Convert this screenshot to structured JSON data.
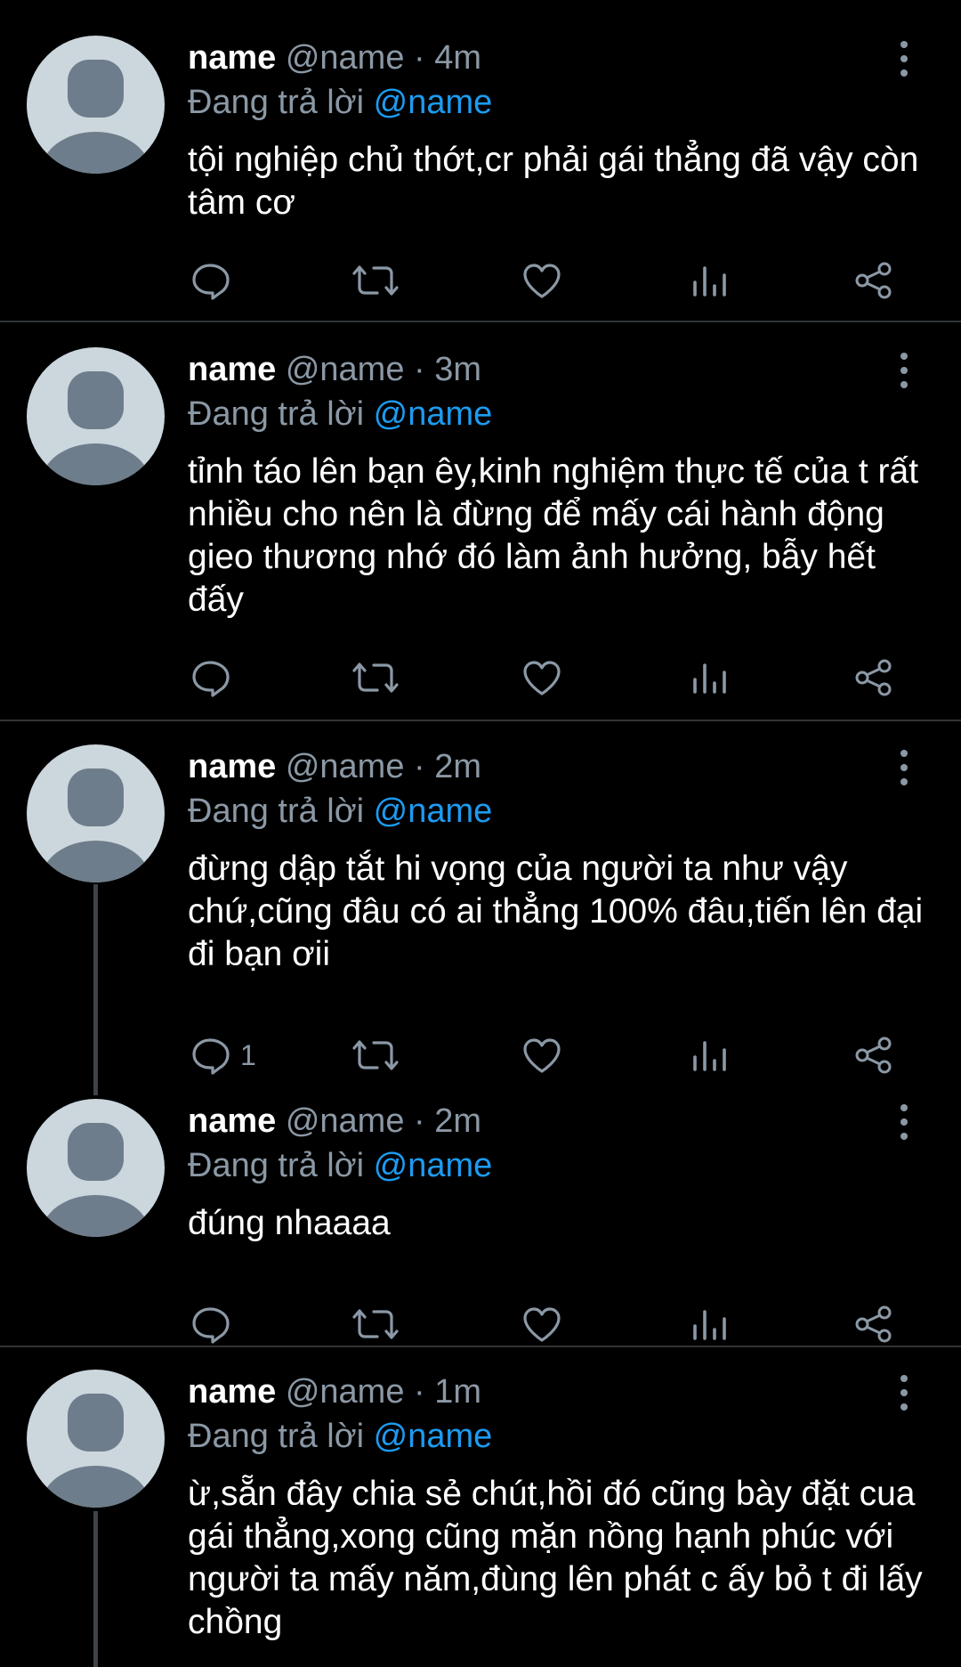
{
  "tweets": [
    {
      "name": "name",
      "handle": "@name",
      "separator": "·",
      "time": "4m",
      "reply_prefix": "Đang trả lời",
      "reply_to": "@name",
      "text": "tội nghiệp chủ thớt,cr phải gái thẳng đã vậy còn tâm cơ",
      "reply_count": ""
    },
    {
      "name": "name",
      "handle": "@name",
      "separator": "·",
      "time": "3m",
      "reply_prefix": "Đang trả lời",
      "reply_to": "@name",
      "text": "tỉnh táo lên bạn êy,kinh nghiệm thực tế của t rất nhiều cho nên là đừng để mấy cái hành động gieo thương nhớ đó làm ảnh hưởng, bẫy hết đấy",
      "reply_count": ""
    },
    {
      "name": "name",
      "handle": "@name",
      "separator": "·",
      "time": "2m",
      "reply_prefix": "Đang trả lời",
      "reply_to": "@name",
      "text": "đừng dập tắt hi vọng của người ta như vậy chứ,cũng đâu có ai thẳng 100% đâu,tiến lên đại đi bạn ơii",
      "reply_count": "1"
    },
    {
      "name": "name",
      "handle": "@name",
      "separator": "·",
      "time": "2m",
      "reply_prefix": "Đang trả lời",
      "reply_to": "@name",
      "text": "đúng nhaaaa",
      "reply_count": ""
    },
    {
      "name": "name",
      "handle": "@name",
      "separator": "·",
      "time": "1m",
      "reply_prefix": "Đang trả lời",
      "reply_to": "@name",
      "text": "ừ,sẵn đây chia sẻ chút,hồi đó cũng bày đặt cua gái thẳng,xong cũng mặn nồng hạnh phúc với người ta mấy năm,đùng lên phát c ấy bỏ t đi lấy chồng",
      "reply_count": ""
    }
  ],
  "icons": {
    "reply": "reply-bubble-icon",
    "retweet": "retweet-icon",
    "like": "heart-icon",
    "views": "analytics-icon",
    "share": "share-icon",
    "more": "more-vertical-icon"
  },
  "colors": {
    "background": "#000000",
    "text": "#ffffff",
    "muted": "#8b98a5",
    "mention": "#1d9bf0",
    "divider": "#2f3336",
    "avatar_bg": "#ccd6dd",
    "avatar_fg": "#6e7d8b"
  }
}
